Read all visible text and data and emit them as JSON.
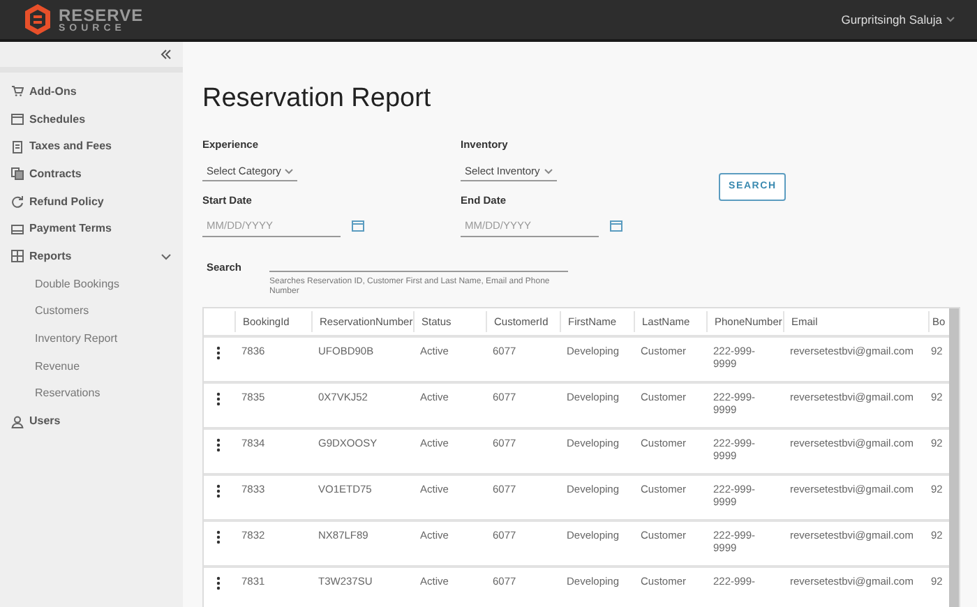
{
  "header": {
    "logo": {
      "line_1": "RESERVE",
      "line_2": "SOURCE"
    },
    "user_menu": "Gurpritsingh Saluja"
  },
  "sidebar": {
    "items": [
      {
        "kind": "cart",
        "label": "Add-Ons"
      },
      {
        "kind": "calendar",
        "label": "Schedules"
      },
      {
        "kind": "document",
        "label": "Taxes and Fees"
      },
      {
        "kind": "copies",
        "label": "Contracts"
      },
      {
        "kind": "refresh",
        "label": "Refund Policy"
      },
      {
        "kind": "card",
        "label": "Payment Terms"
      },
      {
        "kind": "table",
        "label": "Reports",
        "expanded": true,
        "children": [
          {
            "label": "Double Bookings"
          },
          {
            "label": "Customers"
          },
          {
            "label": "Inventory Report"
          },
          {
            "label": "Revenue"
          },
          {
            "label": "Reservations"
          }
        ]
      },
      {
        "kind": "person",
        "label": "Users"
      }
    ]
  },
  "page_title": "Reservation Report",
  "filters": {
    "experience": {
      "label": "Experience",
      "value": "Select Category"
    },
    "inventory": {
      "label": "Inventory",
      "value": "Select Inventory"
    },
    "start_date": {
      "label": "Start Date",
      "placeholder": "MM/DD/YYYY"
    },
    "end_date": {
      "label": "End Date",
      "placeholder": "MM/DD/YYYY"
    },
    "search_button": "SEARCH"
  },
  "search": {
    "label": "Search",
    "hint": "Searches Reservation ID, Customer First and Last Name, Email and Phone Number"
  },
  "table": {
    "columns": [
      "BookingId",
      "ReservationNumber",
      "Status",
      "CustomerId",
      "FirstName",
      "LastName",
      "PhoneNumber",
      "Email",
      "Bo"
    ],
    "rows": [
      [
        "7836",
        "UFOBD90B",
        "Active",
        "6077",
        "Developing",
        "Customer",
        "222-999-9999",
        "reversetestbvi@gmail.com",
        "92"
      ],
      [
        "7835",
        "0X7VKJ52",
        "Active",
        "6077",
        "Developing",
        "Customer",
        "222-999-9999",
        "reversetestbvi@gmail.com",
        "92"
      ],
      [
        "7834",
        "G9DXOOSY",
        "Active",
        "6077",
        "Developing",
        "Customer",
        "222-999-9999",
        "reversetestbvi@gmail.com",
        "92"
      ],
      [
        "7833",
        "VO1ETD75",
        "Active",
        "6077",
        "Developing",
        "Customer",
        "222-999-9999",
        "reversetestbvi@gmail.com",
        "92"
      ],
      [
        "7832",
        "NX87LF89",
        "Active",
        "6077",
        "Developing",
        "Customer",
        "222-999-9999",
        "reversetestbvi@gmail.com",
        "92"
      ],
      [
        "7831",
        "T3W237SU",
        "Active",
        "6077",
        "Developing",
        "Customer",
        "222-999-",
        "reversetestbvi@gmail.com",
        "92"
      ]
    ]
  }
}
